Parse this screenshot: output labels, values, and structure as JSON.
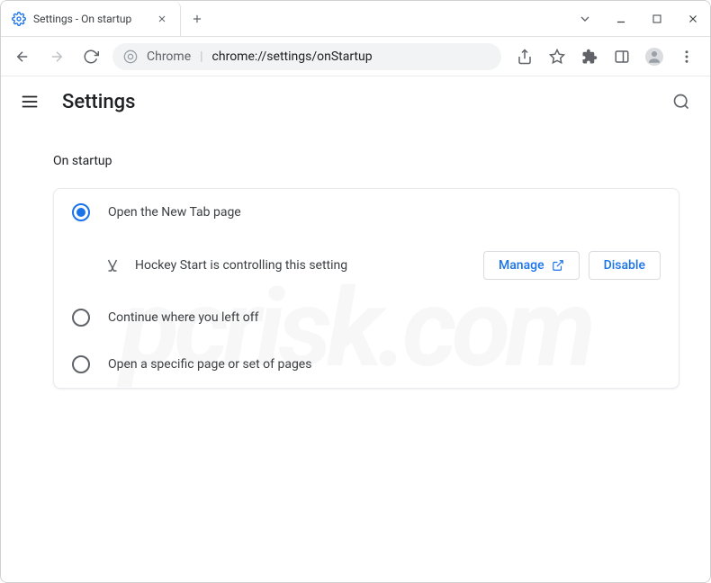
{
  "window": {
    "tab_title": "Settings - On startup"
  },
  "omnibox": {
    "scheme_label": "Chrome",
    "url_path": "chrome://settings/onStartup"
  },
  "app": {
    "title": "Settings"
  },
  "section": {
    "title": "On startup"
  },
  "startup": {
    "options": [
      {
        "label": "Open the New Tab page",
        "checked": true
      },
      {
        "label": "Continue where you left off",
        "checked": false
      },
      {
        "label": "Open a specific page or set of pages",
        "checked": false
      }
    ],
    "extension_notice": "Hockey Start is controlling this setting",
    "manage_label": "Manage",
    "disable_label": "Disable"
  }
}
